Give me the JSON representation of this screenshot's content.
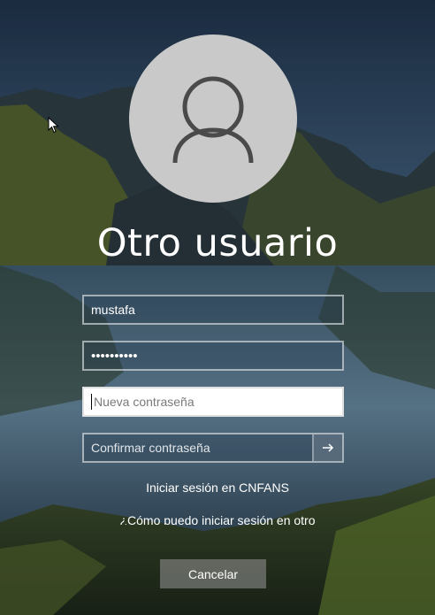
{
  "user": {
    "name": "Otro usuario"
  },
  "form": {
    "username_value": "mustafa",
    "password_masked": "••••••••••",
    "new_password_placeholder": "Nueva contraseña",
    "confirm_password_placeholder": "Confirmar contraseña"
  },
  "links": {
    "sign_in_domain": "Iniciar sesión en CNFANS",
    "how_to_sign_in": "¿Cómo puedo iniciar sesión en otro"
  },
  "buttons": {
    "cancel": "Cancelar"
  },
  "icons": {
    "avatar": "user-icon",
    "submit": "arrow-right-icon",
    "pointer": "mouse-cursor-icon"
  },
  "colors": {
    "avatar_bg": "#c9c9c9",
    "avatar_glyph": "#4a4a4a",
    "field_border": "#b9c2cc",
    "cancel_bg": "#8c8c8c"
  }
}
